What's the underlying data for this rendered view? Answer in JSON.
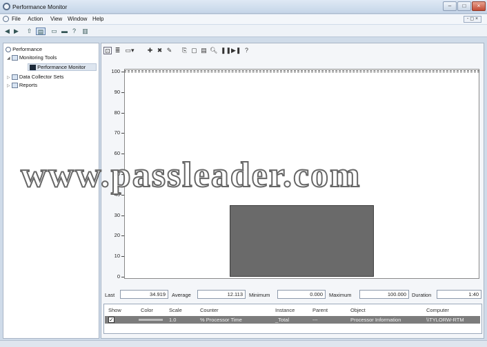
{
  "window": {
    "title": "Performance Monitor"
  },
  "menu": {
    "items": [
      "File",
      "Action",
      "View",
      "Window",
      "Help"
    ]
  },
  "tree": {
    "items": [
      {
        "label": "Performance"
      },
      {
        "label": "Monitoring Tools"
      },
      {
        "label": "Performance Monitor"
      },
      {
        "label": "Data Collector Sets"
      },
      {
        "label": "Reports"
      }
    ]
  },
  "graph": {
    "y_ticks": [
      "100",
      "90",
      "80",
      "70",
      "60",
      "50",
      "40",
      "30",
      "20",
      "10",
      "0"
    ]
  },
  "chart_data": {
    "type": "bar",
    "categories": [
      "% Processor Time"
    ],
    "values": [
      35
    ],
    "ylim": [
      0,
      100
    ],
    "grid": false
  },
  "stats": {
    "last_label": "Last",
    "last_value": "34.919",
    "average_label": "Average",
    "average_value": "12.113",
    "minimum_label": "Minimum",
    "minimum_value": "0.000",
    "maximum_label": "Maximum",
    "maximum_value": "100.000",
    "duration_label": "Duration",
    "duration_value": "1:40"
  },
  "counters": {
    "headers": [
      "Show",
      "Color",
      "Scale",
      "Counter",
      "Instance",
      "Parent",
      "Object",
      "Computer"
    ],
    "row": {
      "scale": "1.0",
      "counter": "% Processor Time",
      "instance": "_Total",
      "parent": "---",
      "object": "Processor Information",
      "computer": "\\\\TYLORW-RTM"
    }
  },
  "watermark": "www.passleader.com",
  "colors": {
    "bar": "#6a6a6a",
    "selection": "#7c7c7c",
    "chrome": "#cfdbe9"
  }
}
